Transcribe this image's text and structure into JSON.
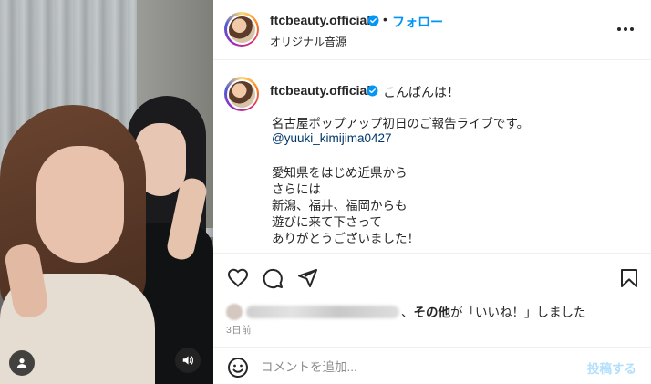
{
  "header": {
    "username": "ftcbeauty.official",
    "separator": "•",
    "follow_label": "フォロー",
    "audio_label": "オリジナル音源",
    "more_icon": "more-horizontal-icon"
  },
  "caption": {
    "username": "ftcbeauty.official",
    "first_line": "こんばんは！",
    "line2": "名古屋ポップアップ初日のご報告ライブです。",
    "mention": "@yuuki_kimijima0427",
    "line4": "愛知県をはじめ近県から",
    "line5": "さらには",
    "line6": "新潟、福井、福岡からも",
    "line7": "遊びに来て下さって",
    "line8": "ありがとうございました！"
  },
  "likes": {
    "suffix_bold": "その他",
    "suffix_text": "が「いいね！」しました",
    "comma": "、"
  },
  "timestamp": "3日前",
  "comment_bar": {
    "placeholder": "コメントを追加...",
    "post_label": "投稿する"
  },
  "colors": {
    "accent_blue": "#0095f6",
    "verified_blue": "#0095f6",
    "post_disabled": "#b2dffc",
    "mention": "#00376b"
  },
  "icons": [
    "heart-icon",
    "comment-icon",
    "send-icon",
    "bookmark-icon",
    "emoji-icon",
    "user-tag-icon",
    "speaker-icon",
    "verified-badge-icon"
  ]
}
